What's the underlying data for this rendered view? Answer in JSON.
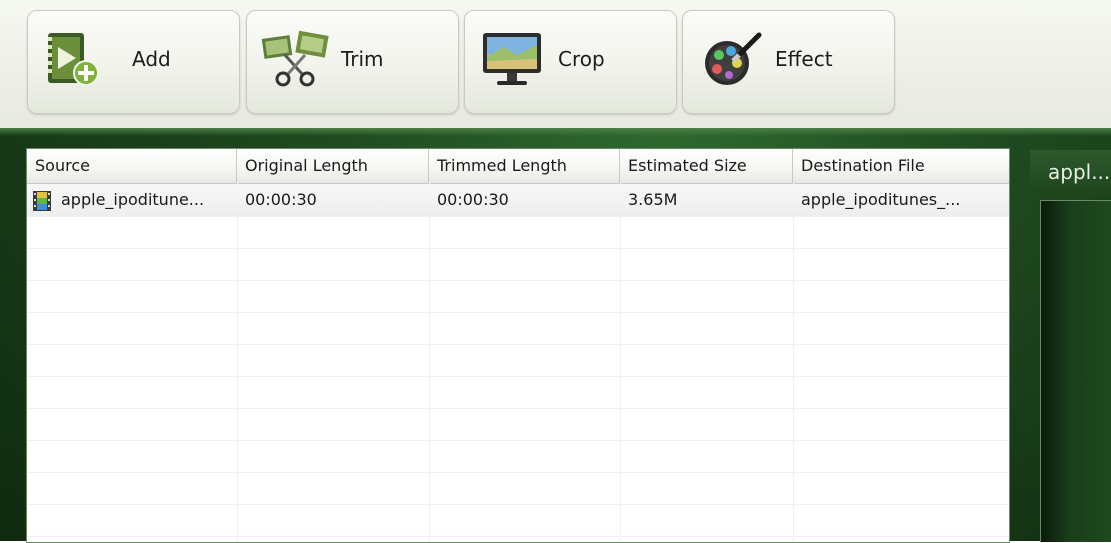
{
  "toolbar": {
    "buttons": [
      {
        "label": "Add",
        "icon": "add-video-icon"
      },
      {
        "label": "Trim",
        "icon": "scissors-film-icon"
      },
      {
        "label": "Crop",
        "icon": "monitor-landscape-icon"
      },
      {
        "label": "Effect",
        "icon": "color-palette-brush-icon"
      }
    ]
  },
  "file_list": {
    "columns": [
      "Source",
      "Original Length",
      "Trimmed Length",
      "Estimated Size",
      "Destination File"
    ],
    "rows": [
      {
        "source": "apple_ipoditune...",
        "original_length": "00:00:30",
        "trimmed_length": "00:00:30",
        "estimated_size": "3.65M",
        "destination_file": "apple_ipoditunes_..."
      }
    ]
  },
  "preview": {
    "title": "appl..."
  },
  "colors": {
    "frame_green": "#1f4a20",
    "button_bg": "#f1f3ec"
  }
}
